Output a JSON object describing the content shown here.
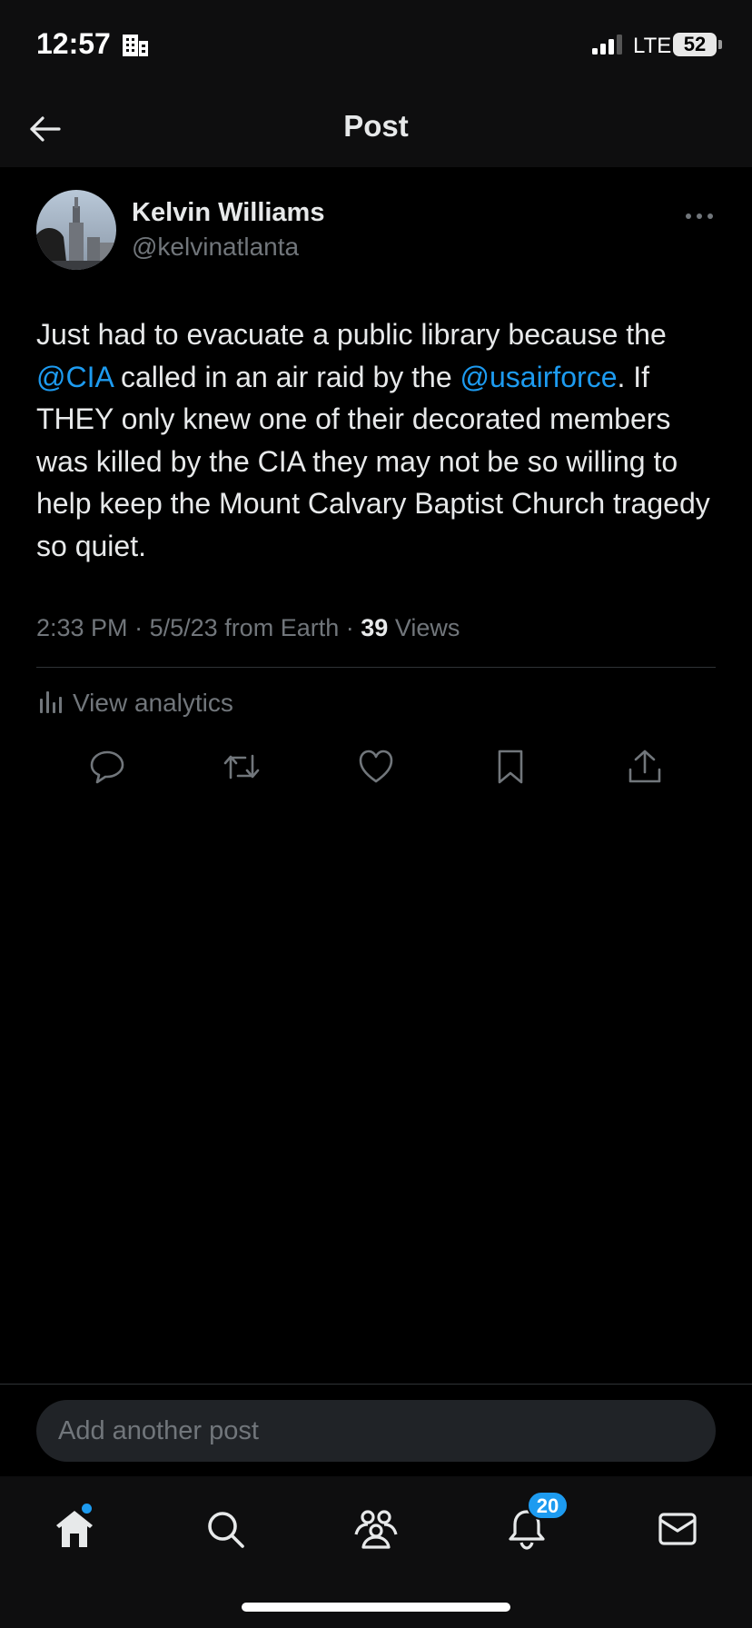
{
  "status_bar": {
    "time": "12:57",
    "network": "LTE",
    "battery": "52"
  },
  "header": {
    "title": "Post"
  },
  "post": {
    "author_name": "Kelvin Williams",
    "author_handle": "@kelvinatlanta",
    "text_segments": [
      {
        "text": "Just had to evacuate a public library because the ",
        "mention": false
      },
      {
        "text": "@CIA",
        "mention": true
      },
      {
        "text": " called in an air raid by the ",
        "mention": false
      },
      {
        "text": "@usairforce",
        "mention": true
      },
      {
        "text": ".  If THEY only knew one of their decorated members was killed by the CIA they may not be so willing to help keep the Mount Calvary Baptist Church tragedy so quiet.",
        "mention": false
      }
    ],
    "time": "2:33 PM",
    "date": "5/5/23",
    "source": "from Earth",
    "views_count": "39",
    "views_label": "Views",
    "analytics_label": "View analytics"
  },
  "actions": [
    "reply-icon",
    "repost-icon",
    "like-icon",
    "bookmark-icon",
    "share-icon"
  ],
  "compose": {
    "placeholder": "Add another post"
  },
  "tab_bar": {
    "notifications_badge": "20"
  },
  "colors": {
    "accent": "#1d9bf0",
    "background": "#000000",
    "secondary_text": "#71767b",
    "primary_text": "#e7e9ea"
  }
}
